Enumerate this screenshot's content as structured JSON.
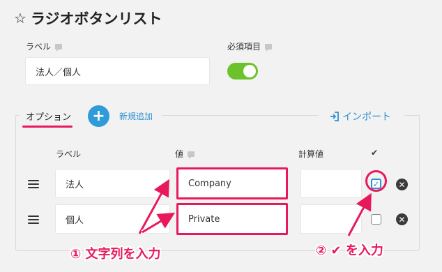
{
  "header": {
    "title": "ラジオボタンリスト",
    "star_icon": "star-outline-icon"
  },
  "label_field": {
    "label": "ラベル",
    "value": "法人／個人"
  },
  "required_field": {
    "label": "必須項目",
    "enabled": true
  },
  "options": {
    "legend": "オプション",
    "add_label": "新規追加",
    "import_label": "インポート",
    "columns": {
      "label": "ラベル",
      "value": "値",
      "calc": "計算値",
      "default": "✔"
    },
    "rows": [
      {
        "label": "法人",
        "value": "Company",
        "calc": "",
        "checked": true
      },
      {
        "label": "個人",
        "value": "Private",
        "calc": "",
        "checked": false
      }
    ]
  },
  "annotations": {
    "step1": "① 文字列を入力",
    "step2": "② ✔ を入力"
  },
  "colors": {
    "accent": "#e8195b",
    "link": "#2f8fd0",
    "toggle_on": "#6cc22b",
    "add_button": "#2f9bd8"
  }
}
